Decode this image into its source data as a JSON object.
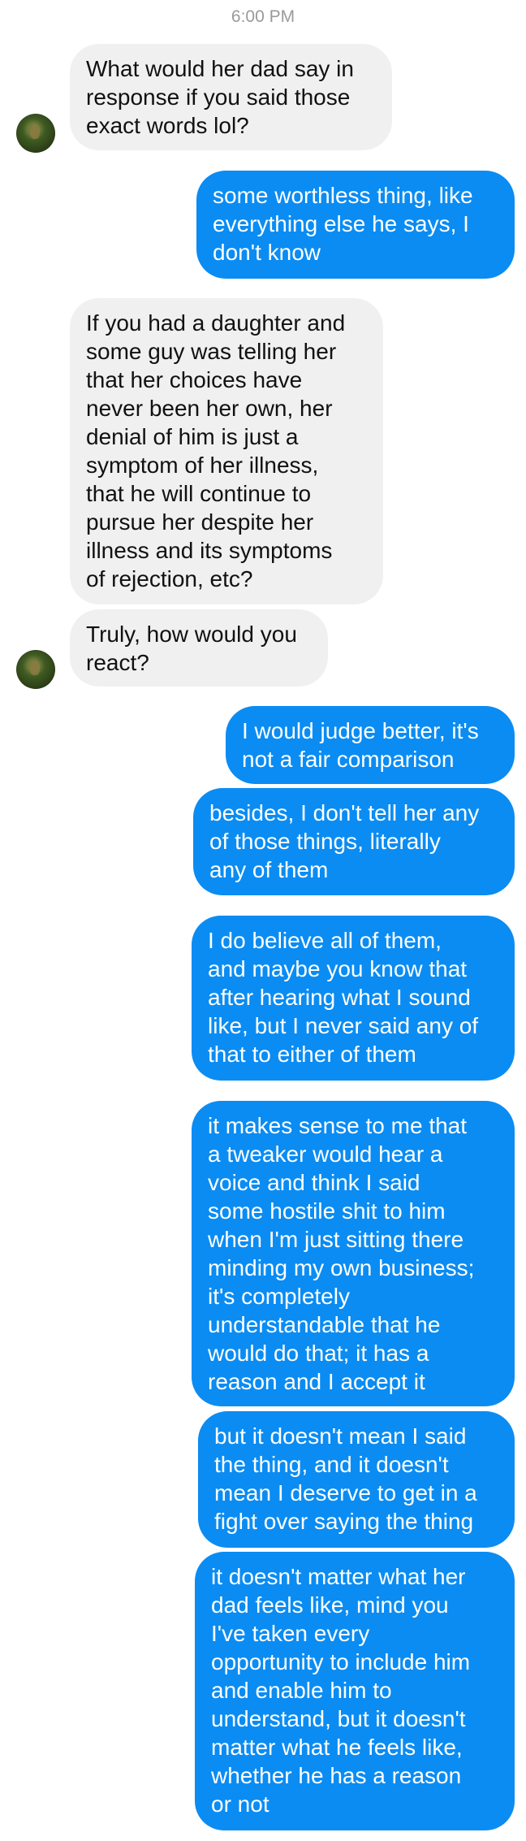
{
  "conversation": {
    "timestamp": "6:00 PM",
    "messages": [
      "What would her dad say in\nresponse if you said those\nexact words lol?",
      "some worthless thing, like\neverything else he says, I\ndon't know",
      "If you had a daughter and\nsome guy was telling her\nthat her choices have\nnever been her own, her\ndenial of him is just a\nsymptom of her illness,\nthat he will continue to\npursue her despite her\nillness and its symptoms\nof rejection, etc?",
      "Truly, how would you\nreact?",
      "I would judge better, it's\nnot a fair comparison",
      "besides, I don't tell her any\nof those things, literally\nany of them",
      "I do believe all of them,\nand maybe you know that\nafter hearing what I sound\nlike, but I never said any of\nthat to either of them",
      "it makes sense to me that\na tweaker would hear a\nvoice and think I said\nsome hostile shit to him\nwhen I'm just sitting there\nminding my own business;\nit's completely\nunderstandable that he\nwould do that; it has a\nreason and I accept it",
      "but it doesn't mean I said\nthe thing, and it doesn't\nmean I deserve to get in a\nfight over saying the thing",
      "it doesn't matter what her\ndad feels like, mind you\nI've taken every\nopportunity to include him\nand enable him to\nunderstand, but it doesn't\nmatter what he feels like,\nwhether he has a reason\nor not"
    ]
  },
  "colors": {
    "incoming_bubble": "#f1f0f0",
    "outgoing_bubble": "#0a8cf3",
    "incoming_text": "#111111",
    "outgoing_text": "#ffffff",
    "timestamp_text": "#9a9a9a"
  },
  "icons": {
    "avatar": "contact-avatar-icon"
  }
}
